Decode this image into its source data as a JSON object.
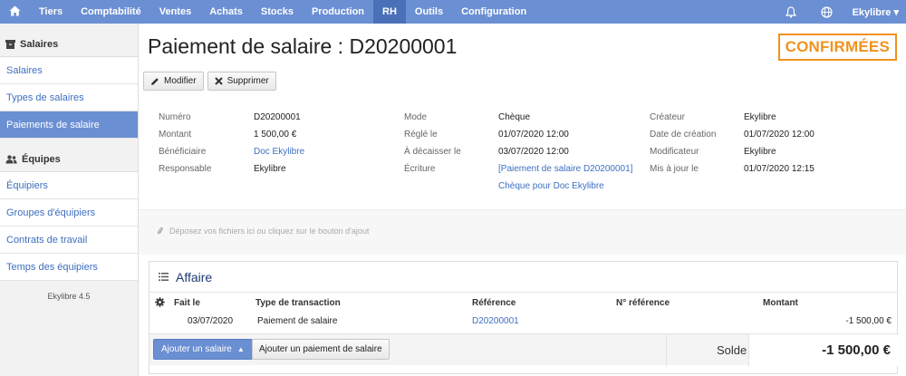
{
  "nav": {
    "home_icon": "home-icon",
    "items": [
      "Tiers",
      "Comptabilité",
      "Ventes",
      "Achats",
      "Stocks",
      "Production",
      "RH",
      "Outils",
      "Configuration"
    ],
    "active": "RH",
    "user": "Ekylibre",
    "accent": "#6b8fd3",
    "active_color": "#4a70b7"
  },
  "sidebar": {
    "section1": {
      "title": "Salaires",
      "items": [
        "Salaires",
        "Types de salaires",
        "Paiements de salaire"
      ]
    },
    "section2": {
      "title": "Équipes",
      "items": [
        "Équipiers",
        "Groupes d'équipiers",
        "Contrats de travail",
        "Temps des équipiers"
      ]
    },
    "active": "Paiements de salaire",
    "version": "Ekylibre 4.5"
  },
  "page": {
    "title": "Paiement de salaire : D20200001",
    "status": "CONFIRMÉES",
    "status_color": "#f0921e"
  },
  "toolbar": {
    "edit_label": "Modifier",
    "delete_label": "Supprimer"
  },
  "fields": {
    "col1": [
      {
        "label": "Numéro",
        "value": "D20200001"
      },
      {
        "label": "Montant",
        "value": "1 500,00 €"
      },
      {
        "label": "Bénéficiaire",
        "value": "Doc Ekylibre"
      },
      {
        "label": "Responsable",
        "value": "Ekylibre"
      }
    ],
    "col2": [
      {
        "label": "Mode",
        "value": "Chèque"
      },
      {
        "label": "Réglé le",
        "value": "01/07/2020 12:00"
      },
      {
        "label": "À décaisser le",
        "value": "03/07/2020 12:00"
      },
      {
        "label": "Écriture",
        "value": "[Paiement de salaire D20200001]",
        "value2": "Chèque pour Doc Ekylibre"
      }
    ],
    "col3": [
      {
        "label": "Créateur",
        "value": "Ekylibre"
      },
      {
        "label": "Date de création",
        "value": "01/07/2020 12:00"
      },
      {
        "label": "Modificateur",
        "value": "Ekylibre"
      },
      {
        "label": "Mis à jour le",
        "value": "01/07/2020 12:15"
      }
    ]
  },
  "dropzone": {
    "text": "Déposez vos fichiers ici ou cliquez sur le bouton d'ajout"
  },
  "affaire": {
    "title": "Affaire",
    "columns": [
      "Fait le",
      "Type de transaction",
      "Référence",
      "N° référence",
      "Montant"
    ],
    "rows": [
      {
        "date": "03/07/2020",
        "type": "Paiement de salaire",
        "reference": "D20200001",
        "n_reference": "",
        "amount": "-1 500,00 €"
      }
    ],
    "add_salary_label": "Ajouter un salaire",
    "add_payment_label": "Ajouter un paiement de salaire",
    "balance_label": "Solde",
    "balance_value": "-1 500,00 €"
  }
}
